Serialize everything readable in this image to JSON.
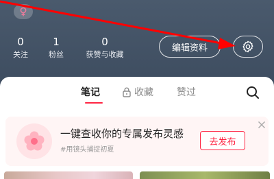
{
  "profile": {
    "gender_icon": "female-icon",
    "stats": [
      {
        "value": "0",
        "label": "关注"
      },
      {
        "value": "1",
        "label": "粉丝"
      },
      {
        "value": "0",
        "label": "获赞与收藏"
      }
    ],
    "edit_label": "编辑资料",
    "settings_icon": "gear-icon"
  },
  "tabs": [
    {
      "label": "笔记",
      "active": true
    },
    {
      "label": "收藏",
      "locked": true
    },
    {
      "label": "赞过"
    }
  ],
  "search_icon": "search-icon",
  "promo": {
    "title": "一键查收你的专属发布灵感",
    "subtitle": "#用镜头捕捉初夏",
    "button_label": "去发布",
    "icon": "flower-icon",
    "close_icon": "close-icon"
  },
  "colors": {
    "accent": "#ff2442",
    "header_bg": "#44546a",
    "annotation_arrow": "#ff0000"
  }
}
